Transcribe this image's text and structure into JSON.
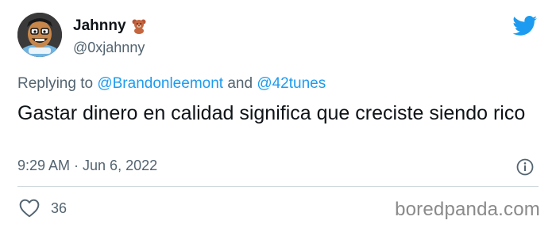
{
  "author": {
    "display_name": "Jahnny",
    "badge_icon": "teddy-bear-icon",
    "handle": "@0xjahnny"
  },
  "reply": {
    "prefix": "Replying to ",
    "mention1": "@Brandonleemont",
    "conjunction": " and ",
    "mention2": "@42tunes"
  },
  "tweet": {
    "text": "Gastar dinero en calidad significa que creciste siendo rico",
    "timestamp": "9:29 AM · Jun 6, 2022"
  },
  "actions": {
    "likes_icon": "heart-icon",
    "likes_count": "36"
  },
  "watermark": "boredpanda.com",
  "colors": {
    "accent": "#1d9bf0",
    "muted": "#536471",
    "text": "#0f1419"
  }
}
